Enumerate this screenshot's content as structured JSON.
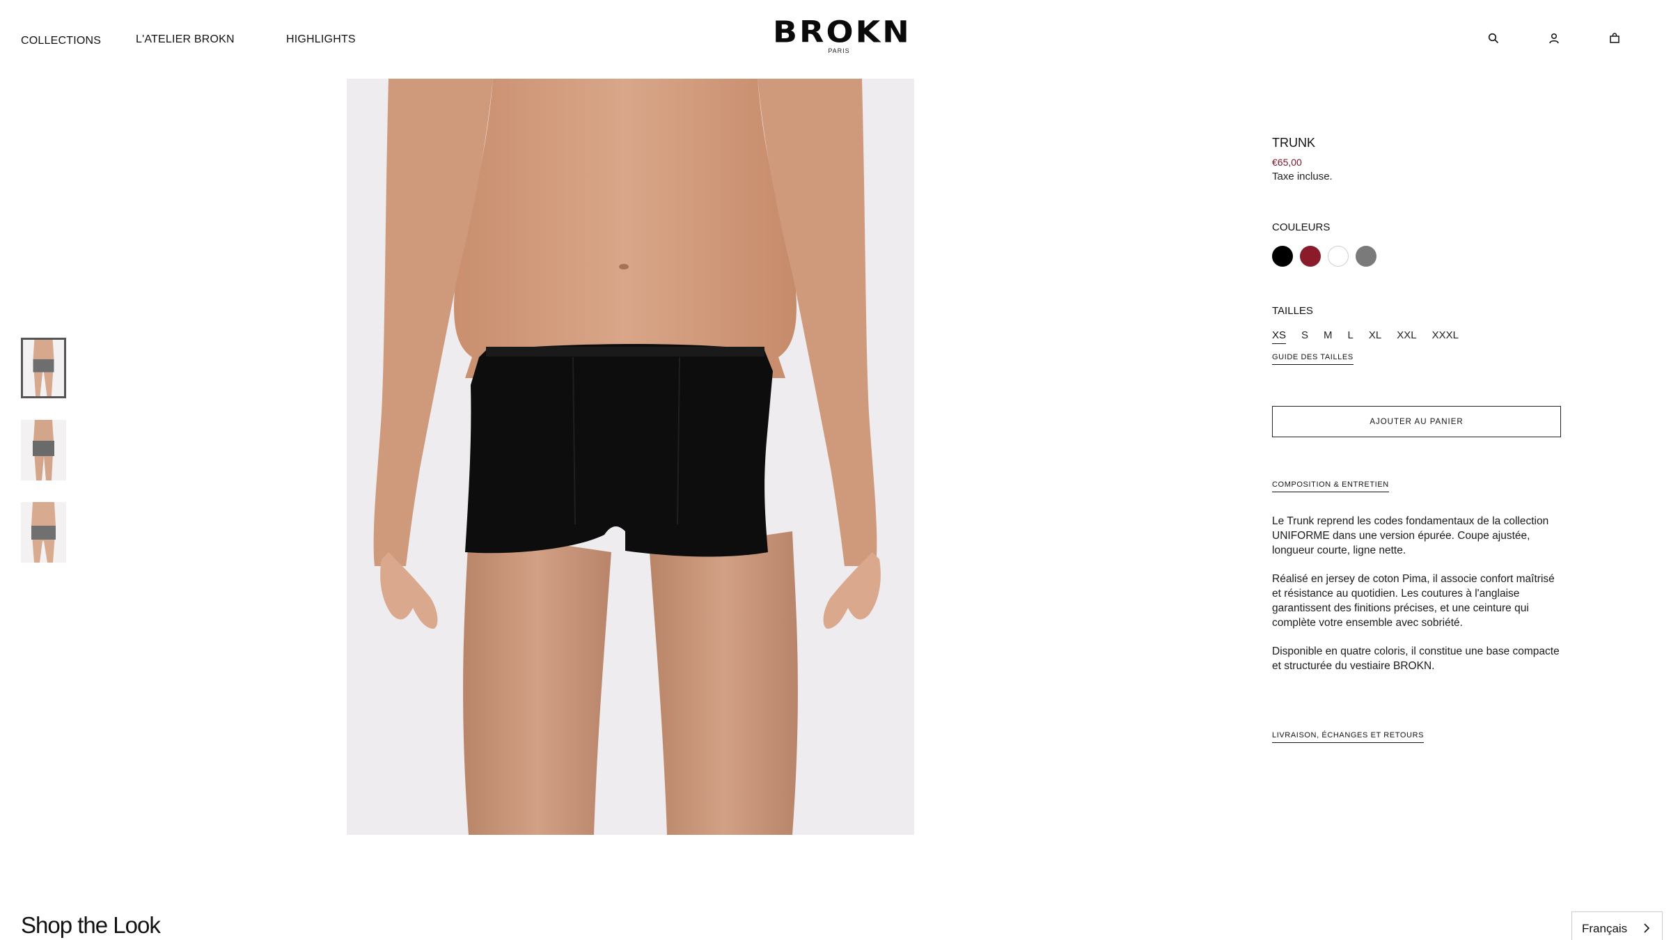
{
  "header": {
    "nav": [
      {
        "label": "COLLECTIONS"
      },
      {
        "label": "L'ATELIER BROKN"
      },
      {
        "label": "HIGHLIGHTS"
      }
    ],
    "logo": {
      "main": "BROKN",
      "sub": "PARIS"
    },
    "icons": [
      "search-icon",
      "account-icon",
      "cart-icon"
    ]
  },
  "product": {
    "title": "TRUNK",
    "price": "€65,00",
    "tax_note": "Taxe incluse.",
    "colors_label": "COULEURS",
    "colors": [
      {
        "name": "noir",
        "hex": "#000000"
      },
      {
        "name": "bordeaux",
        "hex": "#8b1a2b"
      },
      {
        "name": "blanc",
        "hex": "#ffffff"
      },
      {
        "name": "gris",
        "hex": "#7a7a7a"
      }
    ],
    "sizes_label": "TAILLES",
    "sizes": [
      "XS",
      "S",
      "M",
      "L",
      "XL",
      "XXL",
      "XXXL"
    ],
    "selected_size": "XS",
    "size_guide": "GUIDE DES TAILLES",
    "add_to_cart": "AJOUTER AU PANIER",
    "composition_link": "COMPOSITION & ENTRETIEN",
    "description": [
      "Le Trunk reprend les codes fondamentaux de la collection UNIFORME dans une version épurée. Coupe ajustée, longueur courte, ligne nette.",
      "Réalisé en jersey de coton Pima, il associe confort maîtrisé et résistance au quotidien. Les coutures à l'anglaise garantissent des finitions précises, et une ceinture qui complète votre ensemble avec sobriété.",
      "Disponible en quatre coloris, il constitue une base compacte et structurée du vestiaire BROKN."
    ],
    "shipping_link": "LIVRAISON, ÉCHANGES ET RETOURS"
  },
  "gallery": {
    "thumbnails": 3,
    "active_thumbnail": 1
  },
  "footer": {
    "shop_the_look": "Shop the Look",
    "language": "Français"
  },
  "colors": {
    "price": "#7a1428",
    "text": "#111111"
  }
}
